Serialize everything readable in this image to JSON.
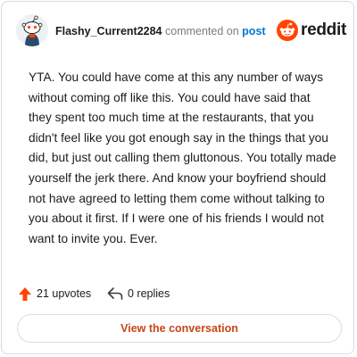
{
  "header": {
    "username": "Flashy_Current2284",
    "action_text": "commented on",
    "post_link": "post",
    "brand_name": "reddit",
    "icons": {
      "avatar": "snoo-avatar",
      "logo": "reddit-logo-icon"
    }
  },
  "comment": {
    "body": "YTA. You could have come at this any number of ways without coming off like this. You could have said that they spent too much time at the restaurants, that you didn't feel like you got enough say in the things that you did, but just out calling them gluttonous. You totally made yourself the jerk there. And know your boyfriend should not have agreed to letting them come without talking to you about it first. If I were one of his friends I would not want to invite you. Ever."
  },
  "stats": {
    "upvotes": "21 upvotes",
    "replies": "0 replies",
    "icons": {
      "upvote": "upvote-arrow-icon",
      "reply": "reply-arrow-icon"
    }
  },
  "actions": {
    "view_conversation": "View the conversation"
  },
  "colors": {
    "brand_orange": "#ff4500",
    "link_blue": "#0079d3",
    "button_text": "#c6471b",
    "meta_gray": "#7c7c7c",
    "border": "#d7dadc"
  }
}
